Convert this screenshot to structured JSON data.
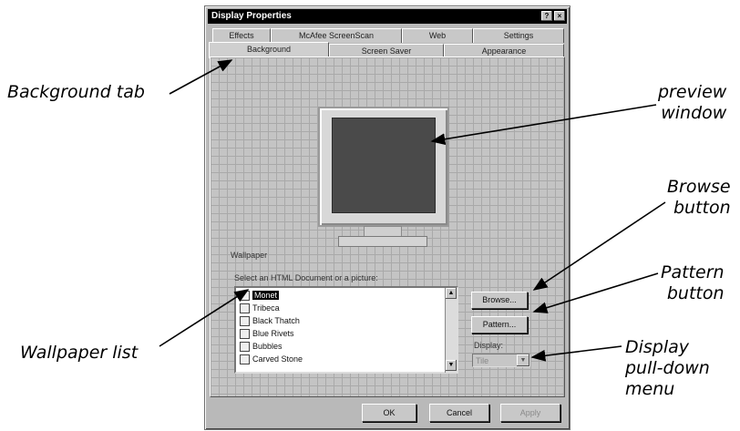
{
  "window": {
    "title": "Display Properties",
    "help_glyph": "?",
    "close_glyph": "×"
  },
  "tabs": {
    "back_row": [
      "Effects",
      "McAfee ScreenScan",
      "Web",
      "Settings"
    ],
    "front_row": [
      "Background",
      "Screen Saver",
      "Appearance"
    ],
    "active": "Background"
  },
  "wallpaper": {
    "group_label": "Wallpaper",
    "instruction": "Select an HTML Document or a picture:",
    "items": [
      "Monet",
      "Tribeca",
      "Black Thatch",
      "Blue Rivets",
      "Bubbles",
      "Carved Stone"
    ],
    "selected": "Monet",
    "browse_label": "Browse...",
    "pattern_label": "Pattern...",
    "display_label": "Display:",
    "display_value": "Tile"
  },
  "footer": {
    "ok_label": "OK",
    "cancel_label": "Cancel",
    "apply_label": "Apply"
  },
  "callouts": {
    "background_tab": "Background tab",
    "preview_window": [
      "preview",
      "window"
    ],
    "browse_button": [
      "Browse",
      "button"
    ],
    "pattern_button": [
      "Pattern",
      "button"
    ],
    "wallpaper_list": "Wallpaper list",
    "display_menu": [
      "Display",
      "pull-down",
      "menu"
    ]
  },
  "icons": {
    "up_arrow": "▲",
    "down_arrow": "▼",
    "list_item_icon": "picture-file-icon"
  }
}
